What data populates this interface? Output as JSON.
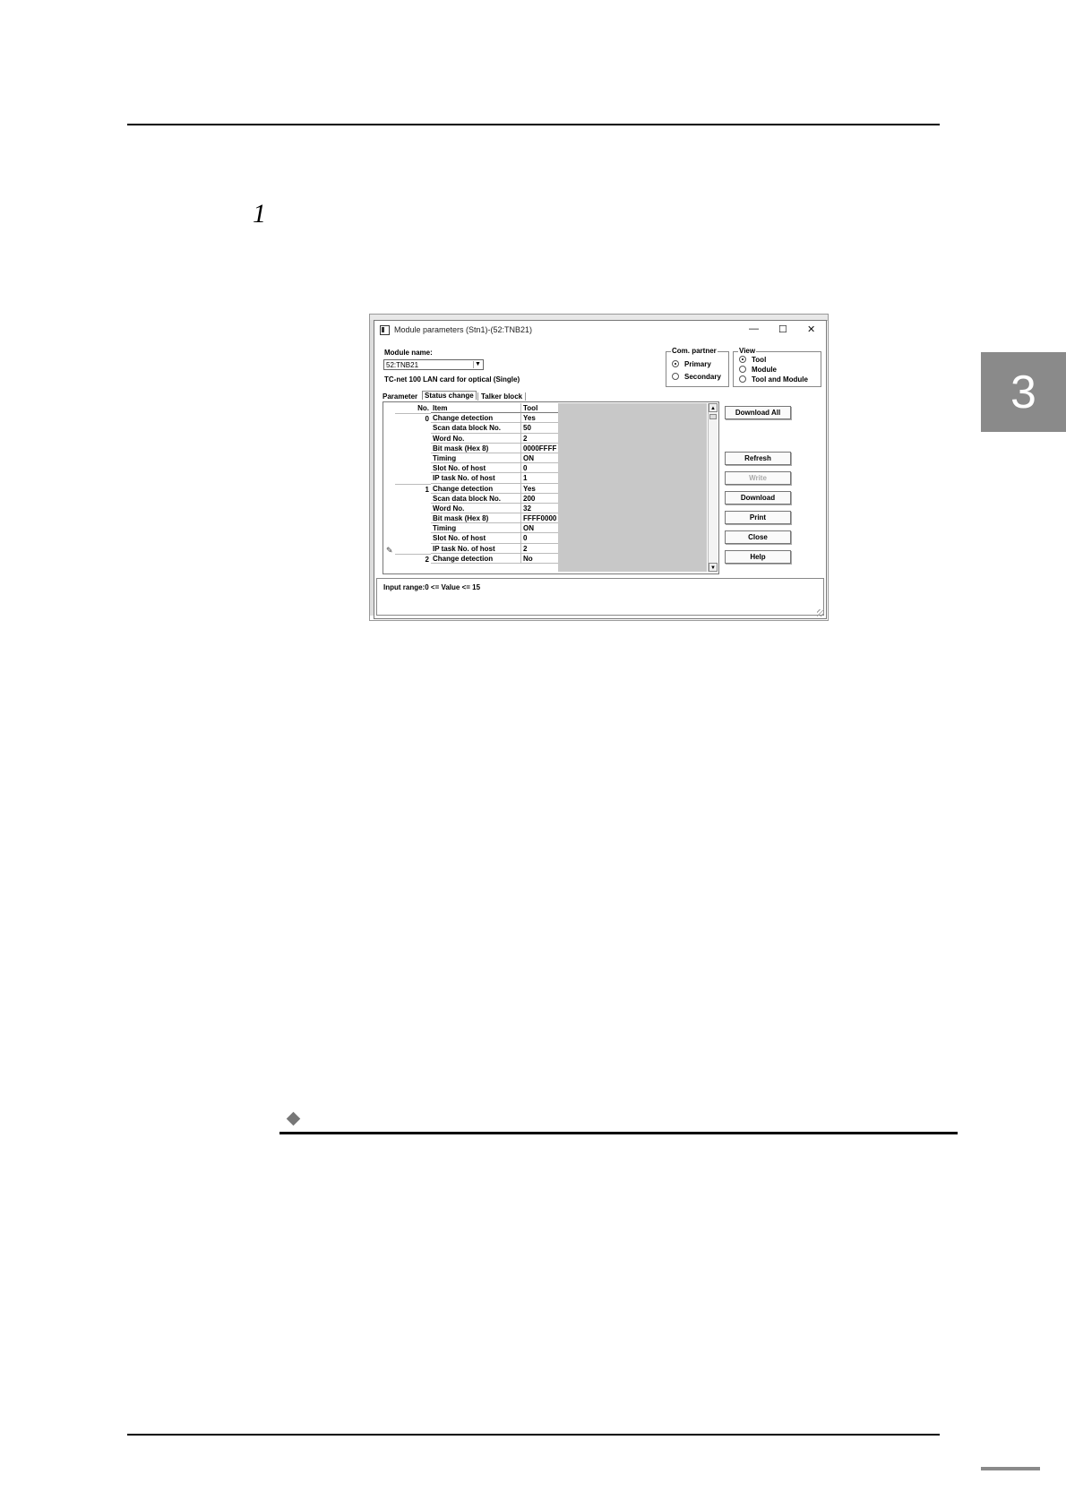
{
  "page": {
    "step_number": "1",
    "chapter_tab": "3"
  },
  "window": {
    "title": "Module parameters (Stn1)-(52:TNB21)",
    "minimize_glyph": "—",
    "maximize_glyph": "☐",
    "close_glyph": "✕"
  },
  "module": {
    "label": "Module name:",
    "selected": "52:TNB21",
    "card_description": "TC-net 100 LAN card for optical (Single)"
  },
  "com_partner": {
    "title": "Com. partner",
    "options": [
      {
        "label": "Primary",
        "selected": true
      },
      {
        "label": "Secondary",
        "selected": false
      }
    ]
  },
  "view": {
    "title": "View",
    "options": [
      {
        "label": "Tool",
        "selected": true
      },
      {
        "label": "Module",
        "selected": false
      },
      {
        "label": "Tool and Module",
        "selected": false
      }
    ]
  },
  "tabs": {
    "parameter": "Parameter",
    "status_change": "Status change",
    "talker_block": "Talker block",
    "active": "Status change"
  },
  "grid": {
    "headers": {
      "no": "No.",
      "item": "Item",
      "tool": "Tool"
    },
    "rows": [
      {
        "no": "0",
        "item": "Change detection",
        "tool": "Yes"
      },
      {
        "no": "",
        "item": "Scan data block No.",
        "tool": "50"
      },
      {
        "no": "",
        "item": "Word No.",
        "tool": "2"
      },
      {
        "no": "",
        "item": "Bit mask (Hex 8)",
        "tool": "0000FFFF"
      },
      {
        "no": "",
        "item": "Timing",
        "tool": "ON"
      },
      {
        "no": "",
        "item": "Slot No. of host",
        "tool": "0"
      },
      {
        "no": "",
        "item": "IP task No. of host",
        "tool": "1"
      },
      {
        "no": "1",
        "item": "Change detection",
        "tool": "Yes"
      },
      {
        "no": "",
        "item": "Scan data block No.",
        "tool": "200"
      },
      {
        "no": "",
        "item": "Word No.",
        "tool": "32"
      },
      {
        "no": "",
        "item": "Bit mask (Hex 8)",
        "tool": "FFFF0000"
      },
      {
        "no": "",
        "item": "Timing",
        "tool": "ON"
      },
      {
        "no": "",
        "item": "Slot No. of host",
        "tool": "0"
      },
      {
        "no": "",
        "item": "IP task No. of host",
        "tool": "2"
      },
      {
        "no": "2",
        "item": "Change detection",
        "tool": "No"
      }
    ]
  },
  "buttons": {
    "download_all": "Download All",
    "refresh": "Refresh",
    "write": "Write",
    "download": "Download",
    "print": "Print",
    "close": "Close",
    "help": "Help"
  },
  "status": {
    "text": "Input range:0 <= Value <= 15"
  },
  "icons": {
    "diamond": "diamond-icon",
    "pencil": "pencil-icon",
    "app": "app-icon"
  }
}
